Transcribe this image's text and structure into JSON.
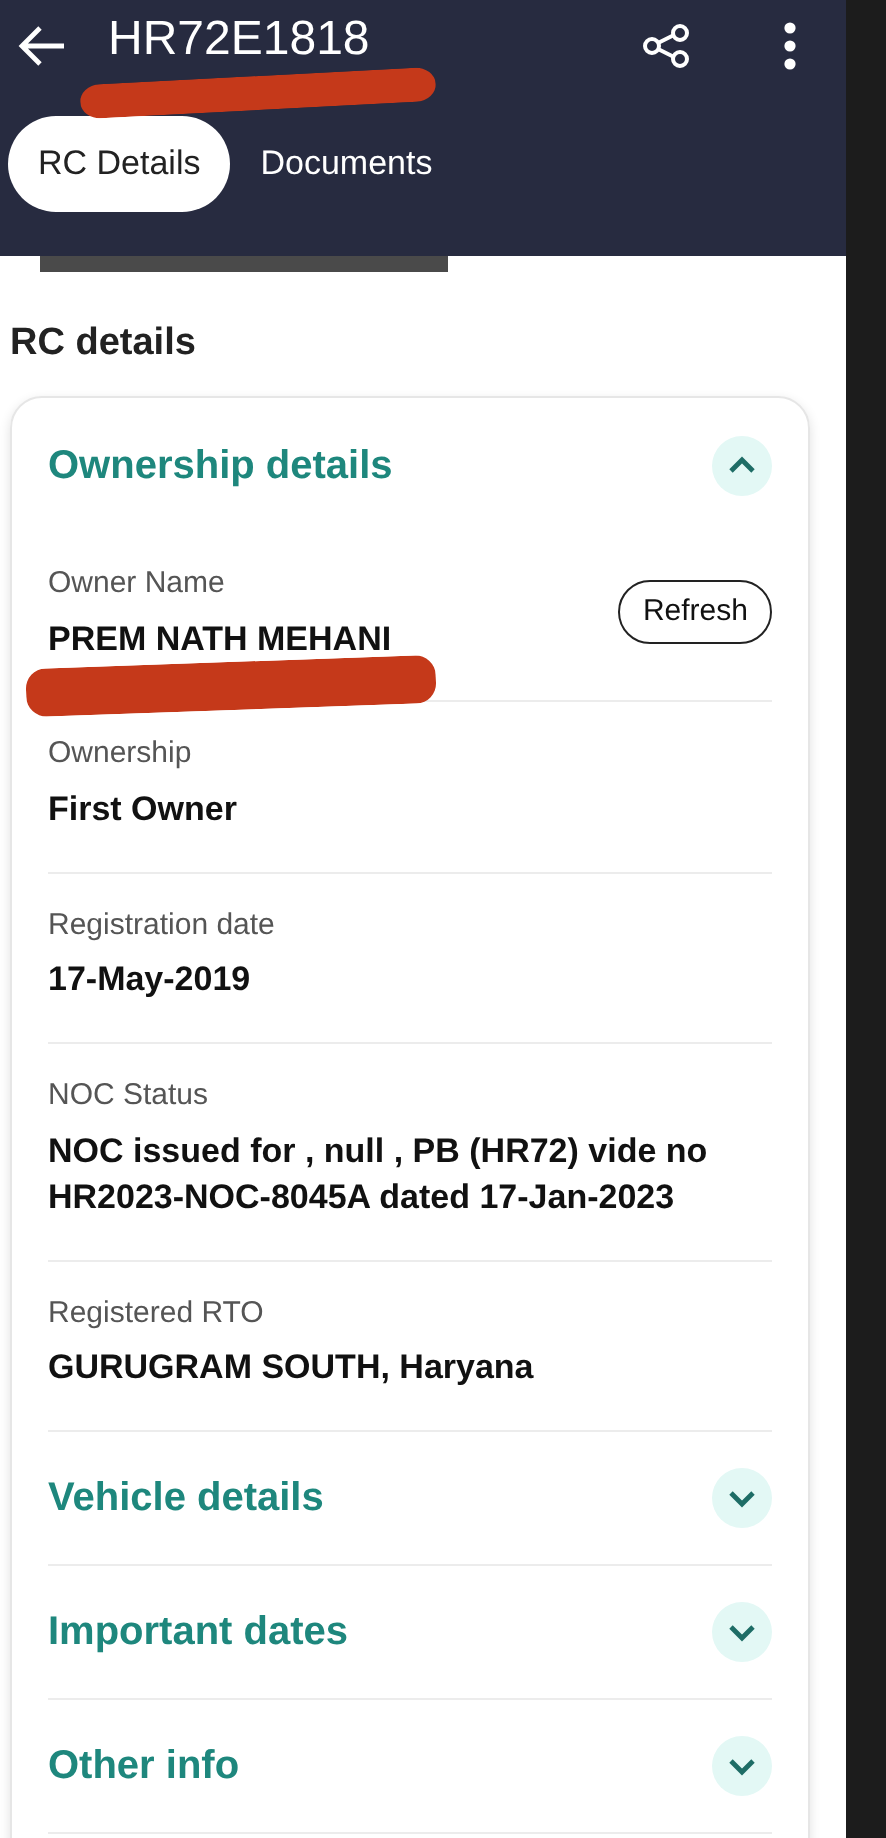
{
  "app_bar": {
    "title": "HR72E1818"
  },
  "tabs": [
    {
      "label": "RC Details",
      "selected": true
    },
    {
      "label": "Documents",
      "selected": false
    }
  ],
  "section_title": "RC details",
  "sections": [
    {
      "title": "Ownership details",
      "expanded": true,
      "fields": [
        {
          "label": "Owner Name",
          "value": "PREM NATH MEHANI",
          "action": "Refresh"
        },
        {
          "label": "Ownership",
          "value": "First Owner"
        },
        {
          "label": "Registration date",
          "value": "17-May-2019"
        },
        {
          "label": "NOC Status",
          "value": "NOC issued for  , null , PB (HR72) vide no HR2023-NOC-8045A dated 17-Jan-2023"
        },
        {
          "label": "Registered RTO",
          "value": "GURUGRAM SOUTH, Haryana"
        }
      ]
    },
    {
      "title": "Vehicle details",
      "expanded": false
    },
    {
      "title": "Important dates",
      "expanded": false
    },
    {
      "title": "Other info",
      "expanded": false
    }
  ]
}
